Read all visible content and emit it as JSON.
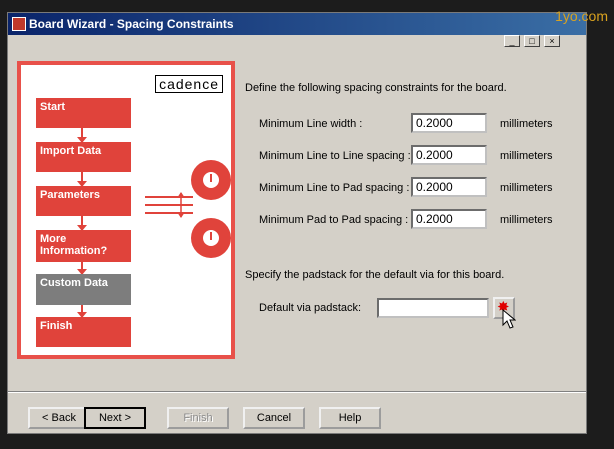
{
  "window": {
    "title": "Board Wizard - Spacing Constraints",
    "watermark": "1yo.com",
    "controls": [
      "_",
      "□",
      "×"
    ]
  },
  "flow": {
    "brand": "cadence",
    "steps": [
      {
        "label": "Start"
      },
      {
        "label": "Import Data"
      },
      {
        "label": "Parameters"
      },
      {
        "label": "More Information?"
      },
      {
        "label": "Custom Data",
        "active": true
      },
      {
        "label": "Finish"
      }
    ],
    "colors": {
      "step": "#e0433b",
      "active": "#7d7d7d",
      "border": "#e8514a"
    }
  },
  "form": {
    "intro": "Define the following spacing constraints for the board.",
    "rows": [
      {
        "label": "Minimum Line width :",
        "value": "0.2000",
        "unit": "millimeters"
      },
      {
        "label": "Minimum Line to Line spacing :",
        "value": "0.2000",
        "unit": "millimeters"
      },
      {
        "label": "Minimum Line to Pad spacing :",
        "value": "0.2000",
        "unit": "millimeters"
      },
      {
        "label": "Minimum Pad to Pad spacing :",
        "value": "0.2000",
        "unit": "millimeters"
      }
    ],
    "padstack_intro": "Specify the padstack for the default via for this board.",
    "via_label": "Default via padstack:",
    "via_value": ""
  },
  "buttons": {
    "back": "< Back",
    "next": "Next >",
    "finish": "Finish",
    "cancel": "Cancel",
    "help": "Help"
  }
}
